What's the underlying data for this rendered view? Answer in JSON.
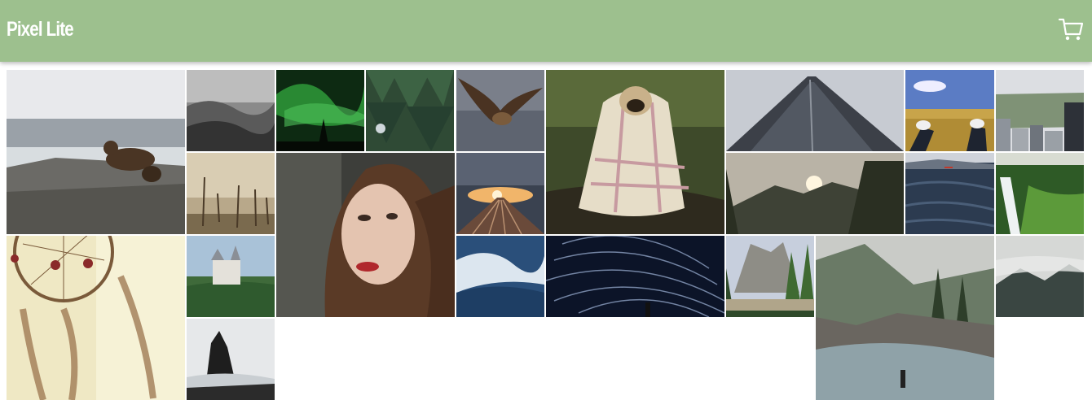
{
  "header": {
    "brand": "Pixel Lite",
    "cart_icon": "shopping-cart-icon",
    "background_color": "#9dc08e"
  },
  "gallery": [
    {
      "name": "photo-bear",
      "subject": "bear-on-rocks"
    },
    {
      "name": "photo-misty-forest",
      "subject": "misty-forest"
    },
    {
      "name": "photo-aurora",
      "subject": "aurora"
    },
    {
      "name": "photo-pine-forest",
      "subject": "pine-forest"
    },
    {
      "name": "photo-eagle",
      "subject": "eagle"
    },
    {
      "name": "photo-pug-blanket",
      "subject": "pug-in-blanket"
    },
    {
      "name": "photo-skyscraper",
      "subject": "skyscraper"
    },
    {
      "name": "photo-sneakers-field",
      "subject": "sneakers-in-field"
    },
    {
      "name": "photo-city-park",
      "subject": "city-park"
    },
    {
      "name": "photo-dead-trees",
      "subject": "dead-trees"
    },
    {
      "name": "photo-woman-portrait",
      "subject": "woman-portrait"
    },
    {
      "name": "photo-railway-sunset",
      "subject": "railway-sunset"
    },
    {
      "name": "photo-mountain-sunset",
      "subject": "mountain-sunset"
    },
    {
      "name": "photo-lake-boat",
      "subject": "lake-boat"
    },
    {
      "name": "photo-waterfall",
      "subject": "waterfall"
    },
    {
      "name": "photo-dreamcatcher",
      "subject": "dreamcatcher"
    },
    {
      "name": "photo-castle",
      "subject": "castle"
    },
    {
      "name": "photo-ocean-wave",
      "subject": "ocean-wave"
    },
    {
      "name": "photo-star-trails",
      "subject": "star-trails"
    },
    {
      "name": "photo-yosemite",
      "subject": "yosemite"
    },
    {
      "name": "photo-river-fog",
      "subject": "river-fog"
    },
    {
      "name": "photo-misty-mountain",
      "subject": "misty-mountain"
    },
    {
      "name": "photo-sea-stack",
      "subject": "sea-stack"
    }
  ]
}
